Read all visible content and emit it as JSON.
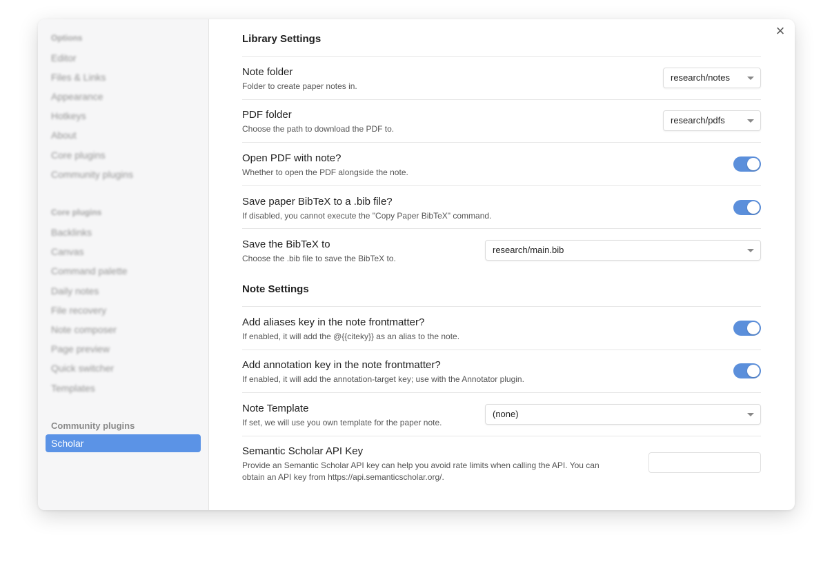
{
  "sidebar": {
    "options_heading": "Options",
    "options_items": [
      "Editor",
      "Files & Links",
      "Appearance",
      "Hotkeys",
      "About",
      "Core plugins",
      "Community plugins"
    ],
    "core_heading": "Core plugins",
    "core_items": [
      "Backlinks",
      "Canvas",
      "Command palette",
      "Daily notes",
      "File recovery",
      "Note composer",
      "Page preview",
      "Quick switcher",
      "Templates"
    ],
    "community_heading": "Community plugins",
    "active_item": "Scholar"
  },
  "close_icon": "×",
  "library": {
    "title": "Library Settings",
    "note_folder": {
      "name": "Note folder",
      "desc": "Folder to create paper notes in.",
      "value": "research/notes"
    },
    "pdf_folder": {
      "name": "PDF folder",
      "desc": "Choose the path to download the PDF to.",
      "value": "research/pdfs"
    },
    "open_pdf": {
      "name": "Open PDF with note?",
      "desc": "Whether to open the PDF alongside the note.",
      "enabled": true
    },
    "save_bibtex": {
      "name": "Save paper BibTeX to a .bib file?",
      "desc": "If disabled, you cannot execute the \"Copy Paper BibTeX\" command.",
      "enabled": true
    },
    "bibtex_path": {
      "name": "Save the BibTeX to",
      "desc": "Choose the .bib file to save the BibTeX to.",
      "value": "research/main.bib"
    }
  },
  "note": {
    "title": "Note Settings",
    "aliases": {
      "name": "Add aliases key in the note frontmatter?",
      "desc": "If enabled, it will add the @{{citeky}} as an alias to the note.",
      "enabled": true
    },
    "annotation": {
      "name": "Add annotation key in the note frontmatter?",
      "desc": "If enabled, it will add the annotation-target key; use with the Annotator plugin.",
      "enabled": true
    },
    "template": {
      "name": "Note Template",
      "desc": "If set, we will use you own template for the paper note.",
      "value": "(none)"
    },
    "api_key": {
      "name": "Semantic Scholar API Key",
      "desc_line1": "Provide an Semantic Scholar API key can help you avoid rate limits when calling the API. You can",
      "desc_line2": "obtain an API key from https://api.semanticscholar.org/.",
      "value": ""
    }
  },
  "colors": {
    "accent": "#5b93e6",
    "toggle_on": "#5b8fdb"
  }
}
